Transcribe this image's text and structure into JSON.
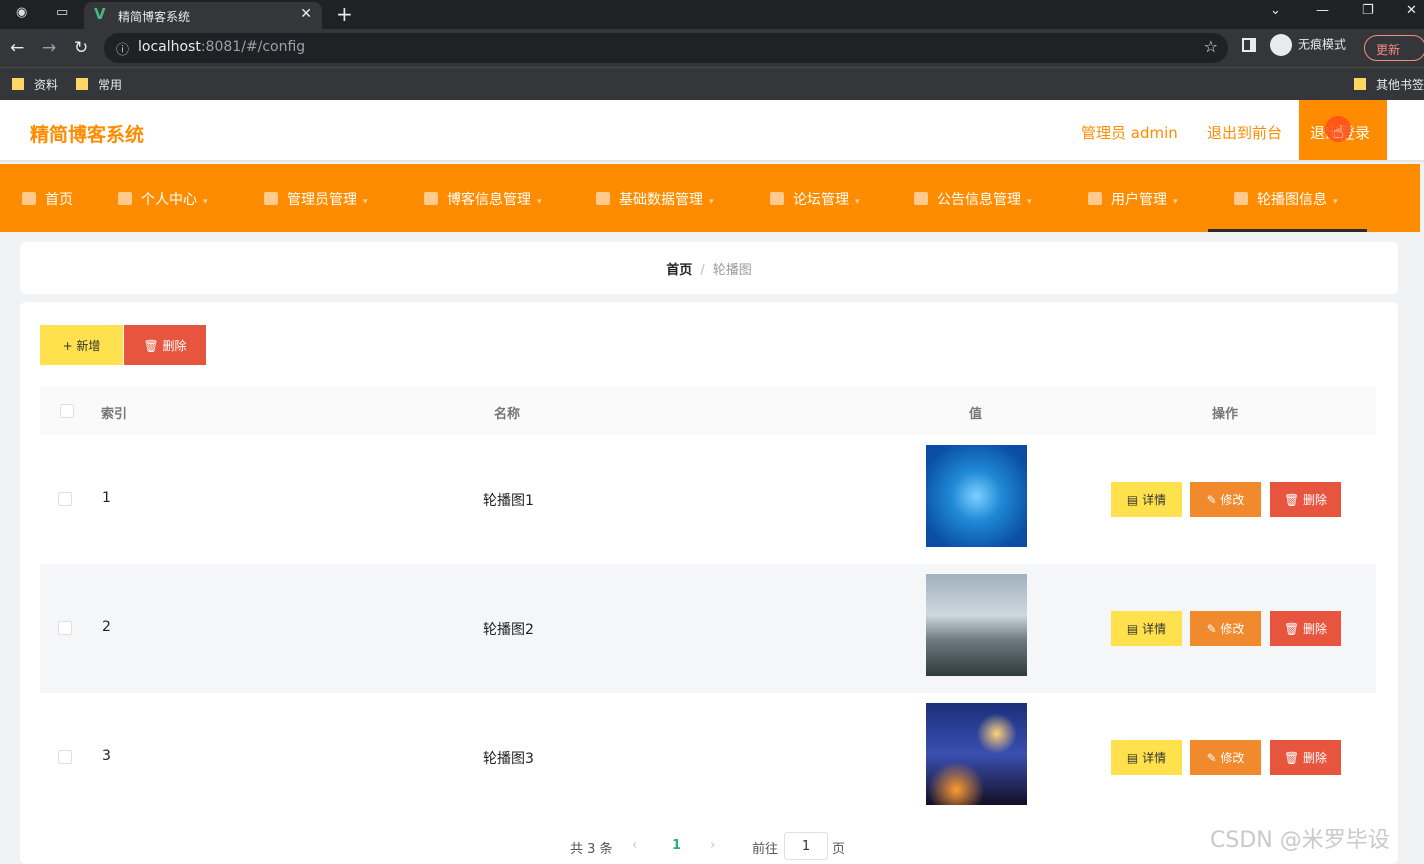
{
  "browser": {
    "tab_title": "精简博客系统",
    "url_host": "localhost",
    "url_rest": ":8081/#/config",
    "incognito_label": "无痕模式",
    "update_label": "更新",
    "bookmarks": [
      "资料",
      "常用"
    ],
    "other_bookmarks": "其他书签"
  },
  "header": {
    "logo": "精简博客系统",
    "admin_label": "管理员 admin",
    "to_front": "退出到前台",
    "logout": "退出登录"
  },
  "menu": [
    {
      "label": "首页"
    },
    {
      "label": "个人中心"
    },
    {
      "label": "管理员管理"
    },
    {
      "label": "博客信息管理"
    },
    {
      "label": "基础数据管理"
    },
    {
      "label": "论坛管理"
    },
    {
      "label": "公告信息管理"
    },
    {
      "label": "用户管理"
    },
    {
      "label": "轮播图信息"
    }
  ],
  "breadcrumb": {
    "home": "首页",
    "separator": "/",
    "current": "轮播图"
  },
  "actions": {
    "add": "+ 新增",
    "delete": "🗑 删除"
  },
  "table": {
    "headers": {
      "index": "索引",
      "name": "名称",
      "value": "值",
      "ops": "操作"
    },
    "rows": [
      {
        "index": "1",
        "name": "轮播图1"
      },
      {
        "index": "2",
        "name": "轮播图2"
      },
      {
        "index": "3",
        "name": "轮播图3"
      }
    ],
    "op_labels": {
      "detail": "▤ 详情",
      "edit": "✎ 修改",
      "delete": "🗑 删除"
    }
  },
  "pager": {
    "total": "共 3 条",
    "current": "1",
    "goto": "前往",
    "page_value": "1",
    "page_unit": "页"
  },
  "watermark": "CSDN @米罗毕设"
}
